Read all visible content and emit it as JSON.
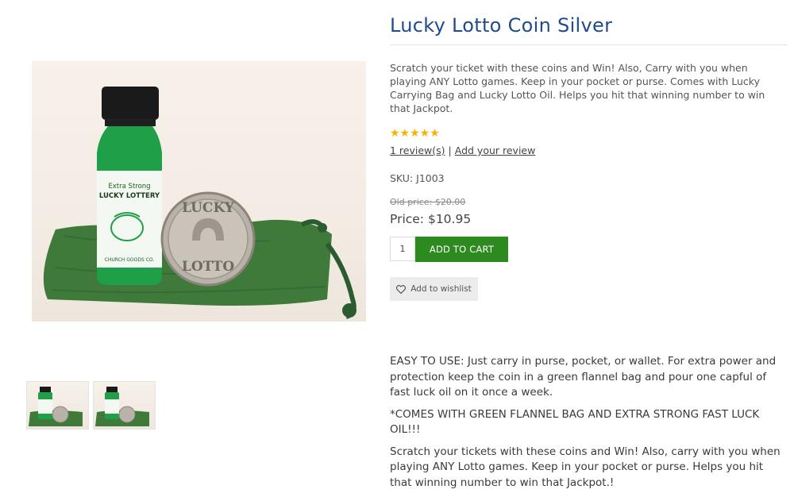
{
  "product": {
    "title": "Lucky Lotto Coin Silver",
    "short_description": "Scratch your ticket with these coins and Win! Also, Carry with you when playing ANY Lotto games. Keep in your pocket or purse. Comes with Lucky Carrying Bag and Lucky Lotto Oil. Helps you hit that winning number to win that Jackpot.",
    "rating": {
      "stars": 5,
      "max": 5,
      "glyphs": "★★★★★"
    },
    "reviews_link": "1 review(s)",
    "review_separator": "|",
    "add_review_link": "Add your review",
    "sku": "SKU: J1003",
    "old_price": "Old price: $20.00",
    "price": "Price: $10.95",
    "quantity": "1",
    "add_to_cart_label": "ADD TO CART",
    "wishlist_label": "Add to wishlist",
    "full_description": [
      "EASY TO USE: Just carry in purse, pocket, or wallet. For extra power and protection keep the coin in a green flannel bag and pour one capful of fast luck oil on it once a week.",
      "*COMES WITH GREEN FLANNEL BAG AND EXTRA STRONG FAST LUCK OIL!!!",
      "Scratch your tickets with these coins and Win! Also, carry with you when playing ANY Lotto games. Keep in your pocket or purse.   Helps you hit that winning number to win that Jackpot.!"
    ]
  },
  "image": {
    "bottle_label_line1": "Extra Strong",
    "bottle_label_line2": "LUCKY LOTTERY",
    "bottle_label_footer": "CHURCH GOODS CO.",
    "coin_text_top": "LUCKY",
    "coin_text_bottom": "LOTTO"
  },
  "colors": {
    "title": "#1f4b8e",
    "add_to_cart": "#2d8a1e",
    "stars": "#f5b400",
    "bag": "#3f7a3a",
    "bottle": "#1fa048"
  }
}
